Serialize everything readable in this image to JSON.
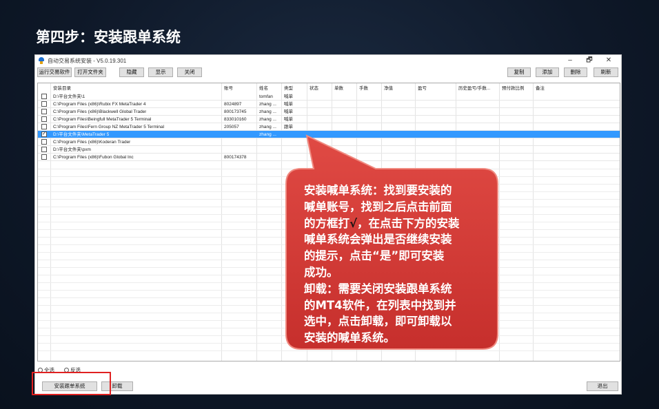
{
  "slide": {
    "title": "第四步：安装跟单系统"
  },
  "window": {
    "title": "自动交易系统安装 - V5.0.19.301",
    "controls": {
      "minimize": "–",
      "maximize": "🗗",
      "close": "✕"
    }
  },
  "toolbar": {
    "run_software": "运行交易软件",
    "open_folder": "打开文件夹",
    "hide": "隐藏",
    "show": "显示",
    "close": "关闭",
    "copy": "复制",
    "add": "添加",
    "delete": "删除",
    "refresh": "刷新"
  },
  "table": {
    "columns": [
      "安装目录",
      "账号",
      "姓名",
      "类型",
      "状态",
      "单数",
      "手数",
      "净值",
      "盈亏",
      "历史盈亏/手数...",
      "预付款比例",
      "备注"
    ],
    "rows": [
      {
        "checked": false,
        "path": "D:\\平台文件夹\\1",
        "account": "",
        "name": "tomfan",
        "type": "喊单",
        "selected": false
      },
      {
        "checked": false,
        "path": "C:\\Program Files (x86)\\Rubix FX MetaTrader 4",
        "account": "8024897",
        "name": "zhang ...",
        "type": "喊单",
        "selected": false
      },
      {
        "checked": false,
        "path": "C:\\Program Files (x86)\\Blackwell Global Trader",
        "account": "800173745",
        "name": "zhang ...",
        "type": "喊单",
        "selected": false
      },
      {
        "checked": false,
        "path": "C:\\Program Files\\Beingfull MetaTrader 5 Terminal",
        "account": "833010160",
        "name": "zhang ...",
        "type": "喊单",
        "selected": false
      },
      {
        "checked": false,
        "path": "C:\\Program Files\\Fern Group NZ MetaTrader 5 Terminal",
        "account": "205057",
        "name": "zhang ...",
        "type": "跟单",
        "selected": false
      },
      {
        "checked": true,
        "path": "D:\\平台文件夹\\MetaTrader 5",
        "account": "",
        "name": "zhang ...",
        "type": "",
        "selected": true
      },
      {
        "checked": false,
        "path": "C:\\Program Files (x86)\\Koderan Trader",
        "account": "",
        "name": "",
        "type": "",
        "selected": false
      },
      {
        "checked": false,
        "path": "D:\\平台文件夹\\pxm",
        "account": "",
        "name": "",
        "type": "",
        "selected": false
      },
      {
        "checked": false,
        "path": "C:\\Program Files (x86)\\Fubon Global Inc",
        "account": "800174378",
        "name": "",
        "type": "",
        "selected": false
      }
    ]
  },
  "bottom": {
    "select_all": "全选",
    "invert": "反选",
    "install_follow": "安装跟单系统",
    "uninstall": "卸载",
    "exit": "退出"
  },
  "callout": {
    "line1": "安装喊单系统：找到要安装的",
    "line2": "喊单账号，找到之后点击前面",
    "line3_a": "的方框打",
    "line3_check": "√",
    "line3_b": "，在点击下方的安装",
    "line4": "喊单系统会弹出是否继续安装",
    "line5": "的提示，点击“是”即可安装",
    "line6": "成功。",
    "line7": "卸载：需要关闭安装跟单系统",
    "line8": "的MT4软件，在列表中找到并",
    "line9": "选中，点击卸载，即可卸载以",
    "line10": "安装的喊单系统。"
  },
  "colors": {
    "background": "#0e1828",
    "callout_red": "#d63a36",
    "selection_blue": "#3399ff",
    "highlight_red": "#e02020"
  }
}
